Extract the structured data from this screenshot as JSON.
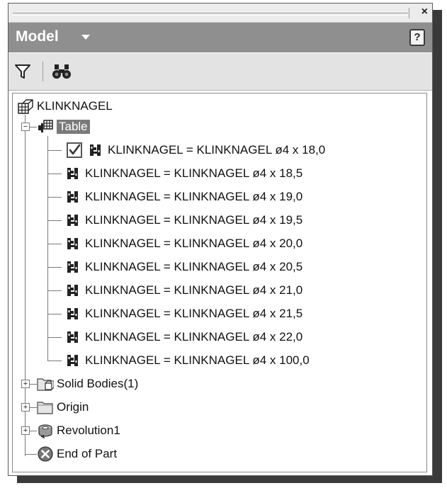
{
  "panel": {
    "title": "Model",
    "close_glyph": "×",
    "help_glyph": "?"
  },
  "toolbar": {
    "filter_icon": "filter-icon",
    "find_icon": "binoculars-icon"
  },
  "tree": {
    "root": {
      "label": "KLINKNAGEL",
      "icon": "ipart-factory-icon"
    },
    "table": {
      "label": "Table",
      "icon": "ipart-table-icon"
    },
    "members": [
      {
        "label": "KLINKNAGEL = KLINKNAGEL ø4 x 18,0",
        "active": true
      },
      {
        "label": "KLINKNAGEL = KLINKNAGEL ø4 x 18,5",
        "active": false
      },
      {
        "label": "KLINKNAGEL = KLINKNAGEL ø4 x 19,0",
        "active": false
      },
      {
        "label": "KLINKNAGEL = KLINKNAGEL ø4 x 19,5",
        "active": false
      },
      {
        "label": "KLINKNAGEL = KLINKNAGEL ø4 x 20,0",
        "active": false
      },
      {
        "label": "KLINKNAGEL = KLINKNAGEL ø4 x 20,5",
        "active": false
      },
      {
        "label": "KLINKNAGEL = KLINKNAGEL ø4 x 21,0",
        "active": false
      },
      {
        "label": "KLINKNAGEL = KLINKNAGEL ø4 x 21,5",
        "active": false
      },
      {
        "label": "KLINKNAGEL = KLINKNAGEL ø4 x 22,0",
        "active": false
      },
      {
        "label": "KLINKNAGEL = KLINKNAGEL ø4 x 100,0",
        "active": false
      }
    ],
    "solid_bodies": {
      "label": "Solid Bodies(1)",
      "icon": "solid-bodies-folder-icon"
    },
    "origin": {
      "label": "Origin",
      "icon": "folder-icon"
    },
    "revolution": {
      "label": "Revolution1",
      "icon": "revolve-feature-icon"
    },
    "end_of_part": {
      "label": "End of Part",
      "icon": "end-of-part-icon"
    }
  },
  "colors": {
    "header_bg": "#8f8f8f",
    "selection_bg": "#7a7a7a",
    "toolbar_bg": "#e3e3e3"
  }
}
